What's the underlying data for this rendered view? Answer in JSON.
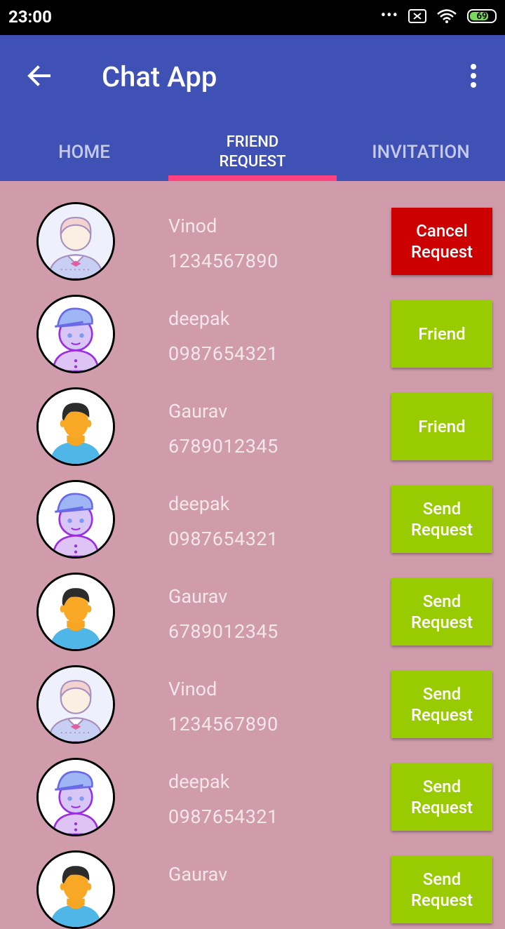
{
  "status": {
    "time": "23:00",
    "dots": "•••",
    "battery": "69"
  },
  "appbar": {
    "title": "Chat App"
  },
  "tabs": [
    {
      "label": "HOME",
      "active": false
    },
    {
      "label": "FRIEND\nREQUEST",
      "active": true
    },
    {
      "label": "INVITATION",
      "active": false
    }
  ],
  "colors": {
    "primary": "#3f51b5",
    "accent": "#ff4081",
    "background": "#d09cac",
    "friend_green": "#99cc00",
    "cancel_red": "#cc0000"
  },
  "rows": [
    {
      "name": "Vinod",
      "phone": "1234567890",
      "avatar": "waiter-avatar",
      "button": "Cancel Request",
      "color": "red"
    },
    {
      "name": "deepak",
      "phone": "0987654321",
      "avatar": "boy-cap-avatar",
      "button": "Friend",
      "color": "green"
    },
    {
      "name": "Gaurav",
      "phone": "6789012345",
      "avatar": "man-avatar",
      "button": "Friend",
      "color": "green"
    },
    {
      "name": "deepak",
      "phone": "0987654321",
      "avatar": "boy-cap-avatar",
      "button": "Send Request",
      "color": "green"
    },
    {
      "name": "Gaurav",
      "phone": "6789012345",
      "avatar": "man-avatar",
      "button": "Send Request",
      "color": "green"
    },
    {
      "name": "Vinod",
      "phone": "1234567890",
      "avatar": "waiter-avatar",
      "button": "Send Request",
      "color": "green"
    },
    {
      "name": "deepak",
      "phone": "0987654321",
      "avatar": "boy-cap-avatar",
      "button": "Send Request",
      "color": "green"
    },
    {
      "name": "Gaurav",
      "phone": "",
      "avatar": "man-avatar",
      "button": "Send Request",
      "color": "green"
    }
  ]
}
